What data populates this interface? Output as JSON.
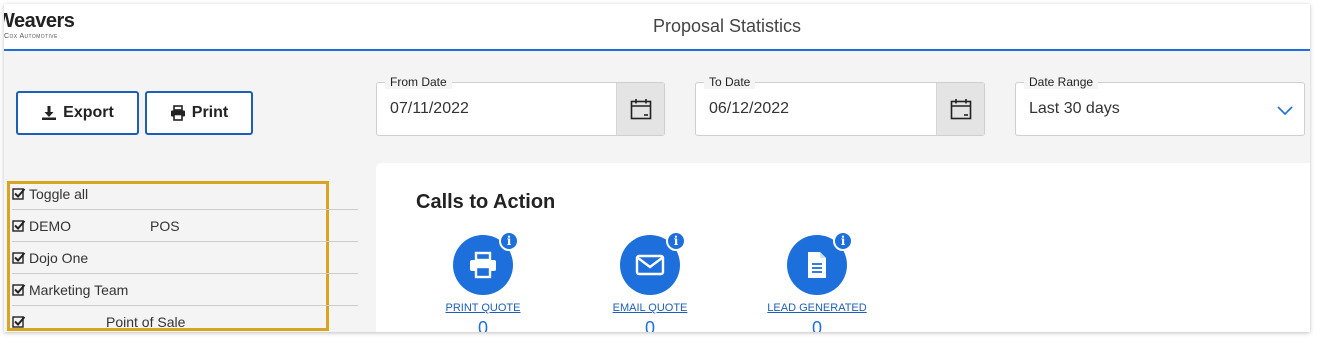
{
  "app": {
    "logo_main": "Weavers",
    "logo_sub": "Cox Automotive",
    "title": "Proposal Statistics"
  },
  "toolbar": {
    "export_label": "Export",
    "print_label": "Print"
  },
  "filters": {
    "from_date": {
      "label": "From Date",
      "value": "07/11/2022"
    },
    "to_date": {
      "label": "To Date",
      "value": "06/12/2022"
    },
    "date_range": {
      "label": "Date Range",
      "value": "Last 30 days"
    }
  },
  "groups": [
    {
      "name": "Toggle all",
      "secondary": "",
      "checked": true
    },
    {
      "name": "DEMO",
      "secondary": "POS",
      "checked": true
    },
    {
      "name": "Dojo One",
      "secondary": "",
      "checked": true
    },
    {
      "name": "Marketing Team",
      "secondary": "",
      "checked": true
    },
    {
      "name": "",
      "secondary": "Point of Sale",
      "checked": true
    }
  ],
  "calls_to_action": {
    "title": "Calls to Action",
    "items": [
      {
        "label": "PRINT QUOTE",
        "count": "0",
        "icon": "printer-icon"
      },
      {
        "label": "EMAIL QUOTE",
        "count": "0",
        "icon": "envelope-icon"
      },
      {
        "label": "LEAD GENERATED",
        "count": "0",
        "icon": "document-icon"
      }
    ]
  },
  "colors": {
    "accent": "#1d6fdc",
    "highlight": "#d9a41f"
  }
}
